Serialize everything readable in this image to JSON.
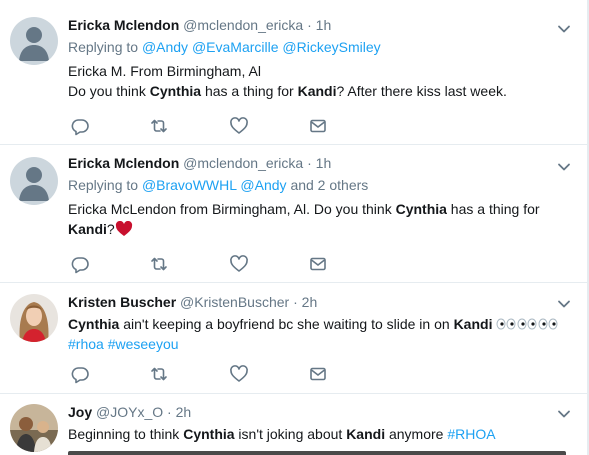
{
  "tweets": [
    {
      "name": "Ericka Mclendon",
      "handle": "@mclendon_ericka",
      "dot": "·",
      "time": "1h",
      "replying_label": "Replying to",
      "reply_mentions": [
        "@Andy",
        "@EvaMarcille",
        "@RickeySmiley"
      ],
      "line1": "Ericka M. From Birmingham, Al",
      "line2_a": "Do you think ",
      "line2_b": "Cynthia",
      "line2_c": " has a thing for ",
      "line2_d": "Kandi",
      "line2_e": "? After there kiss last week."
    },
    {
      "name": "Ericka Mclendon",
      "handle": "@mclendon_ericka",
      "dot": "·",
      "time": "1h",
      "replying_label": "Replying to",
      "reply_mentions": [
        "@BravoWWHL",
        "@Andy"
      ],
      "reply_others": "and 2 others",
      "text_a": "Ericka McLendon from Birmingham, Al. Do you think ",
      "text_b": "Cynthia",
      "text_c": " has a thing for",
      "text_d": "Kandi",
      "text_e": "?"
    },
    {
      "name": "Kristen Buscher",
      "handle": "@KristenBuscher",
      "dot": "·",
      "time": "2h",
      "text_a": "Cynthia",
      "text_b": " ain't keeping a boyfriend bc she waiting to slide in on ",
      "text_c": "Kandi",
      "hashtags": [
        "#rhoa",
        "#weseeyou"
      ]
    },
    {
      "name": "Joy",
      "handle": "@JOYx_O",
      "dot": "·",
      "time": "2h",
      "text_a": "Beginning to think ",
      "text_b": "Cynthia",
      "text_c": " isn't joking about ",
      "text_d": "Kandi",
      "text_e": " anymore ",
      "hashtag": "#RHOA"
    }
  ],
  "colors": {
    "link": "#1da1f2",
    "muted": "#657786",
    "text": "#14171a",
    "heart": "#c8102e"
  }
}
